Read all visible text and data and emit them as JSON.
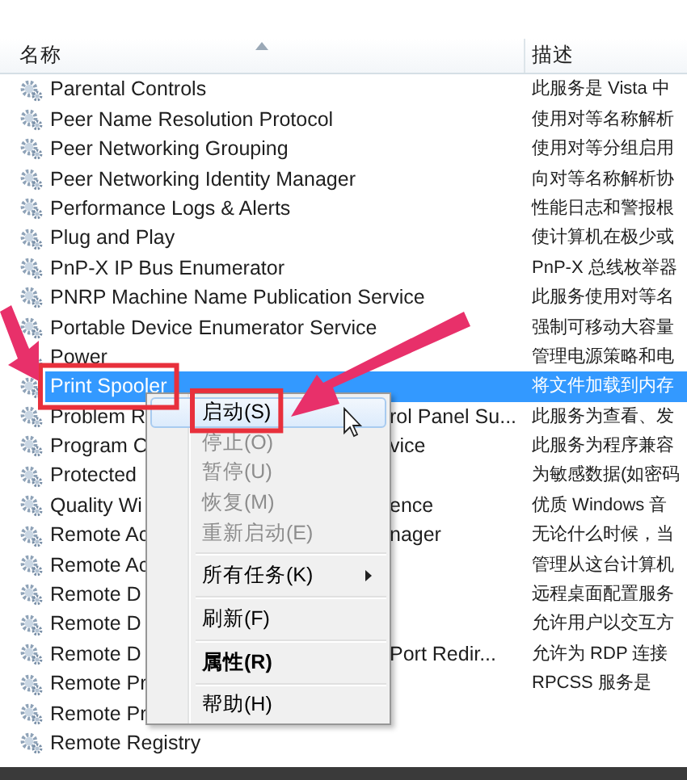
{
  "columns": [
    {
      "label": "名称",
      "sorted": true
    },
    {
      "label": "描述",
      "sorted": false
    }
  ],
  "services": [
    {
      "name": "Parental Controls",
      "description": "此服务是 Vista 中",
      "selected": false,
      "annotated": false
    },
    {
      "name": "Peer Name Resolution Protocol",
      "description": "使用对等名称解析",
      "selected": false,
      "annotated": false
    },
    {
      "name": "Peer Networking Grouping",
      "description": "使用对等分组启用",
      "selected": false,
      "annotated": false
    },
    {
      "name": "Peer Networking Identity Manager",
      "description": "向对等名称解析协",
      "selected": false,
      "annotated": false
    },
    {
      "name": "Performance Logs & Alerts",
      "description": "性能日志和警报根",
      "selected": false,
      "annotated": false
    },
    {
      "name": "Plug and Play",
      "description": "使计算机在极少或",
      "selected": false,
      "annotated": false
    },
    {
      "name": "PnP-X IP Bus Enumerator",
      "description": "PnP-X 总线枚举器",
      "selected": false,
      "annotated": false
    },
    {
      "name": "PNRP Machine Name Publication Service",
      "description": "此服务使用对等名",
      "selected": false,
      "annotated": false
    },
    {
      "name": "Portable Device Enumerator Service",
      "description": "强制可移动大容量",
      "selected": false,
      "annotated": false
    },
    {
      "name": "Power",
      "description": "管理电源策略和电",
      "selected": false,
      "annotated": false
    },
    {
      "name": "Print Spooler",
      "description": "将文件加载到内存",
      "selected": true,
      "annotated": true
    },
    {
      "name": "Problem R",
      "name_tail": "rol Panel Su...",
      "description": "此服务为查看、发",
      "selected": false,
      "annotated": false
    },
    {
      "name": "Program C",
      "name_tail": "vice",
      "description": "此服务为程序兼容",
      "selected": false,
      "annotated": false
    },
    {
      "name": "Protected",
      "description": "为敏感数据(如密码",
      "selected": false,
      "annotated": false
    },
    {
      "name": "Quality Wi",
      "name_tail": "ence",
      "description": "优质 Windows 音",
      "selected": false,
      "annotated": false
    },
    {
      "name": "Remote Ac",
      "name_tail": "nager",
      "description": "无论什么时候，当",
      "selected": false,
      "annotated": false
    },
    {
      "name": "Remote Ac",
      "description": "管理从这台计算机",
      "selected": false,
      "annotated": false
    },
    {
      "name": "Remote D",
      "description": "远程桌面配置服务",
      "selected": false,
      "annotated": false
    },
    {
      "name": "Remote D",
      "description": "允许用户以交互方",
      "selected": false,
      "annotated": false
    },
    {
      "name": "Remote D",
      "name_tail": "Port Redir...",
      "description": "允许为 RDP 连接",
      "selected": false,
      "annotated": false
    },
    {
      "name": "Remote Pr",
      "description": "RPCSS 服务是",
      "selected": false,
      "annotated": false
    },
    {
      "name": "Remote Pr",
      "selected": false,
      "annotated": false
    },
    {
      "name": "Remote Registry",
      "selected": false,
      "annotated": false
    }
  ],
  "context_menu": {
    "items": [
      {
        "kind": "item",
        "label": "启动(S)",
        "disabled": false,
        "highlighted": true,
        "default": false,
        "annotated": true
      },
      {
        "kind": "item",
        "label": "停止(O)",
        "disabled": true,
        "highlighted": false,
        "default": false,
        "annotated": false
      },
      {
        "kind": "item",
        "label": "暂停(U)",
        "disabled": true,
        "highlighted": false,
        "default": false,
        "annotated": false
      },
      {
        "kind": "item",
        "label": "恢复(M)",
        "disabled": true,
        "highlighted": false,
        "default": false,
        "annotated": false
      },
      {
        "kind": "item",
        "label": "重新启动(E)",
        "disabled": true,
        "highlighted": false,
        "default": false,
        "annotated": false
      },
      {
        "kind": "separator"
      },
      {
        "kind": "submenu",
        "label": "所有任务(K)",
        "disabled": false,
        "highlighted": false,
        "default": false,
        "annotated": false
      },
      {
        "kind": "separator"
      },
      {
        "kind": "item",
        "label": "刷新(F)",
        "disabled": false,
        "highlighted": false,
        "default": false,
        "annotated": false
      },
      {
        "kind": "separator"
      },
      {
        "kind": "item",
        "label": "属性(R)",
        "disabled": false,
        "highlighted": false,
        "default": true,
        "annotated": false
      },
      {
        "kind": "separator"
      },
      {
        "kind": "item",
        "label": "帮助(H)",
        "disabled": false,
        "highlighted": false,
        "default": false,
        "annotated": false
      }
    ]
  }
}
